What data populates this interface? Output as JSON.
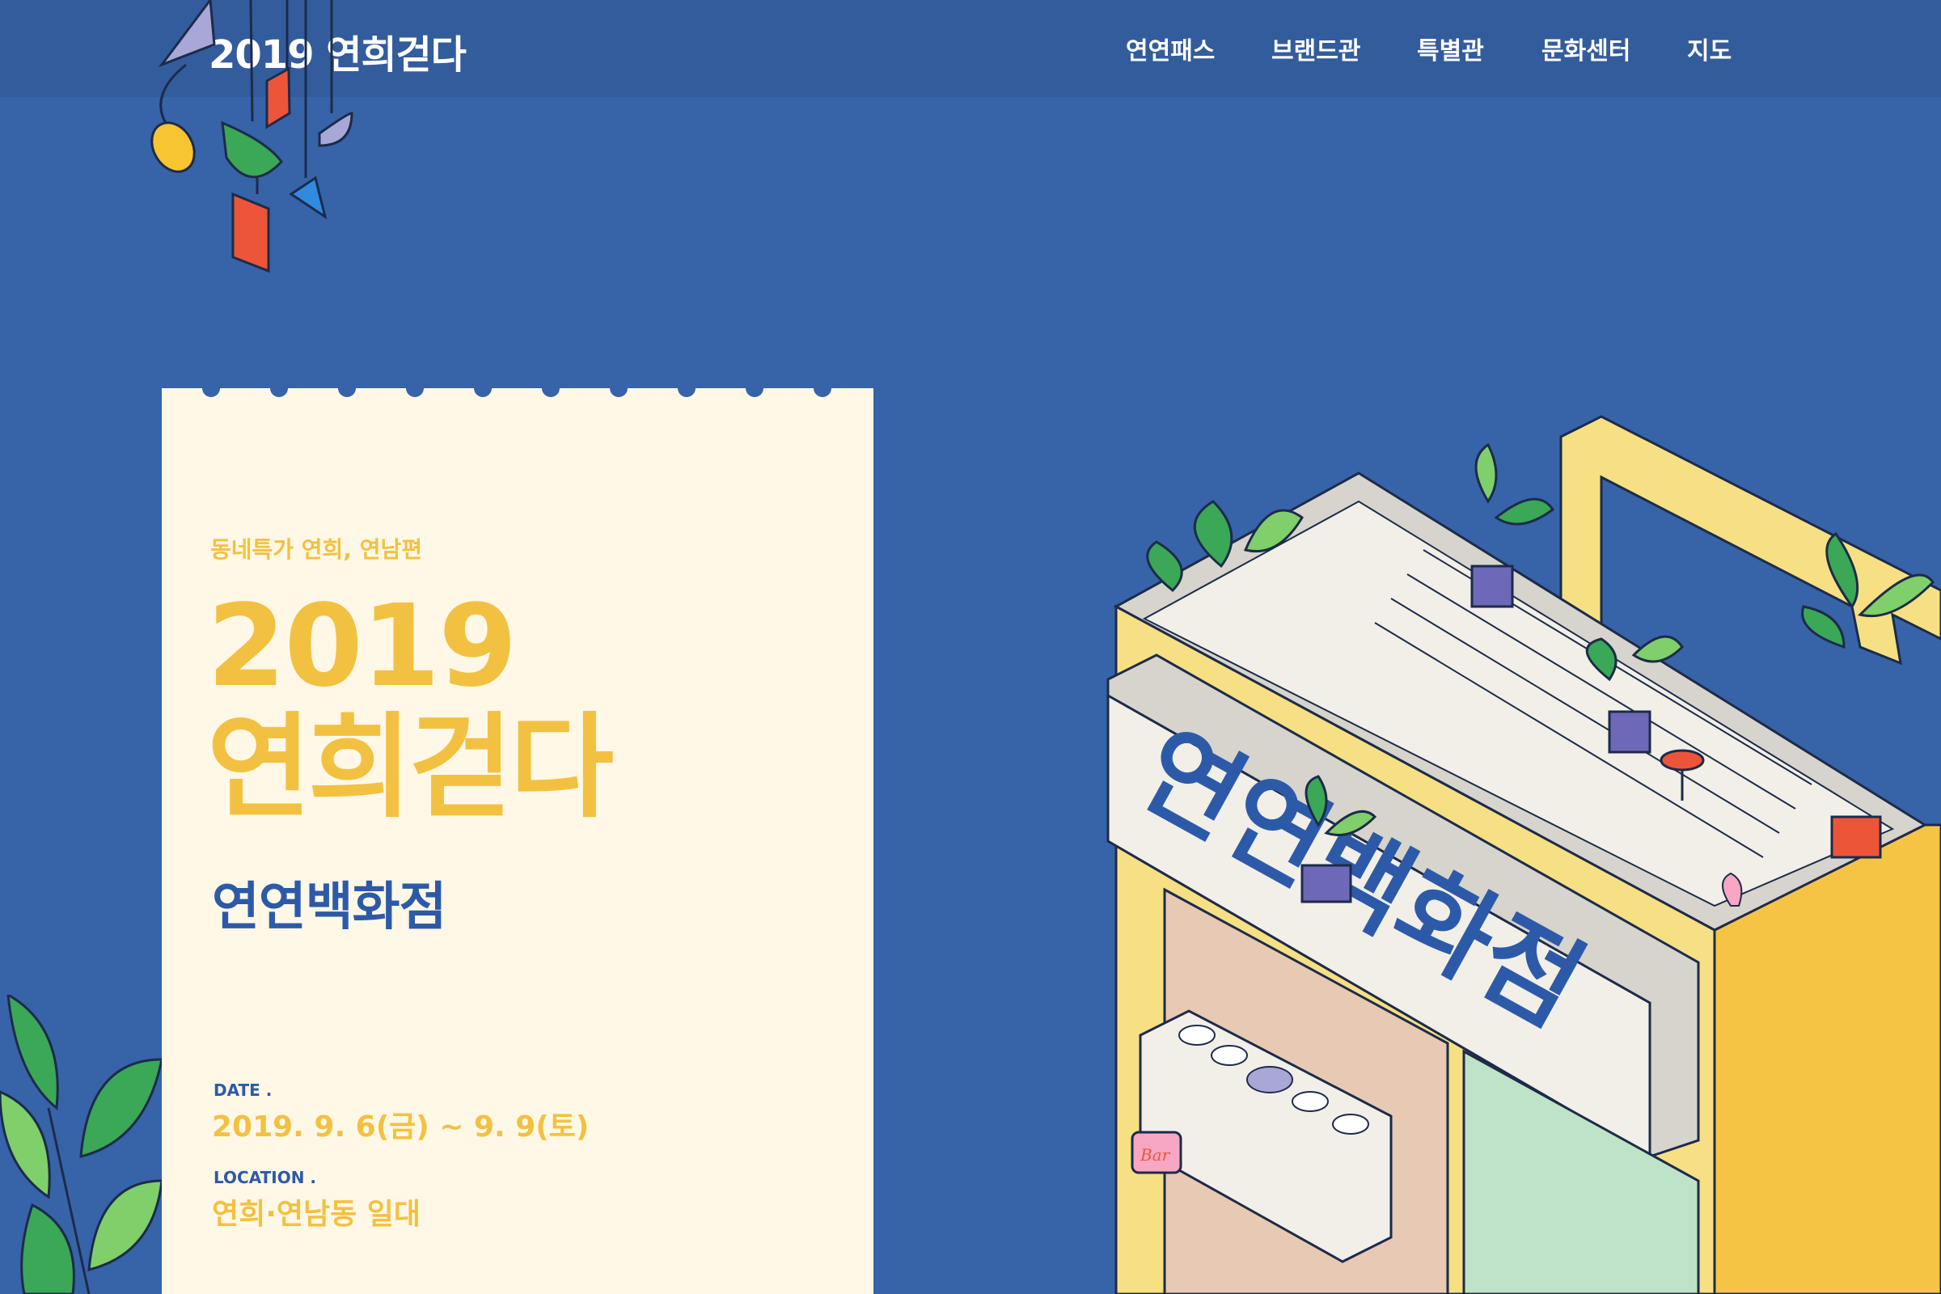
{
  "header": {
    "logo": "2019 연희걷다",
    "nav": [
      "연연패스",
      "브랜드관",
      "특별관",
      "문화센터",
      "지도"
    ]
  },
  "card": {
    "subtitle": "동네특가 연희, 연남편",
    "year": "2019",
    "event_name": "연희걷다",
    "store_name": "연연백화점",
    "date_label": "DATE .",
    "date_value": "2019. 9. 6(금) ~ 9. 9(토)",
    "location_label": "LOCATION .",
    "location_value": "연희·연남동 일대"
  },
  "illustration": {
    "sign_text": "연연백화점",
    "bar_sign": "Bar"
  },
  "colors": {
    "background": "#3763a8",
    "header": "#335c9c",
    "card": "#fff8e7",
    "accent_yellow": "#f3c141",
    "accent_blue": "#2d5aa8"
  }
}
